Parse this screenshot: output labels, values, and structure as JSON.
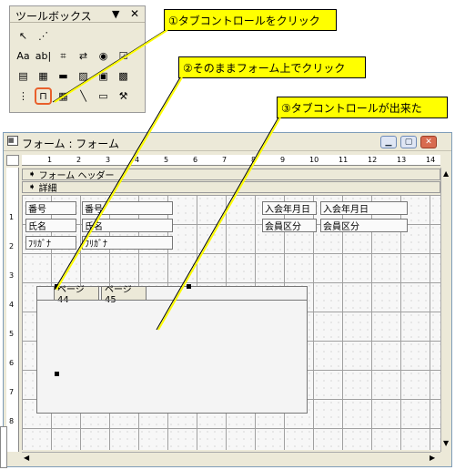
{
  "toolbox": {
    "title": "ツールボックス",
    "buttons": [
      {
        "name": "select-arrow-icon",
        "glyph": "↖"
      },
      {
        "name": "wizard-wand-icon",
        "glyph": "⋰"
      },
      {
        "name": "label-icon",
        "glyph": "Aa"
      },
      {
        "name": "textbox-icon",
        "glyph": "ab|"
      },
      {
        "name": "option-group-icon",
        "glyph": "⌗"
      },
      {
        "name": "toggle-button-icon",
        "glyph": "⇄"
      },
      {
        "name": "option-button-icon",
        "glyph": "◉"
      },
      {
        "name": "checkbox-icon",
        "glyph": "☑"
      },
      {
        "name": "combo-box-icon",
        "glyph": "▤"
      },
      {
        "name": "list-box-icon",
        "glyph": "▦"
      },
      {
        "name": "command-button-icon",
        "glyph": "▬"
      },
      {
        "name": "image-icon",
        "glyph": "▨"
      },
      {
        "name": "unbound-object-icon",
        "glyph": "▣"
      },
      {
        "name": "bound-object-icon",
        "glyph": "▩"
      },
      {
        "name": "page-break-icon",
        "glyph": "⋮"
      },
      {
        "name": "tab-control-icon",
        "glyph": "⊓"
      },
      {
        "name": "subform-icon",
        "glyph": "▦"
      },
      {
        "name": "line-icon",
        "glyph": "╲"
      },
      {
        "name": "rectangle-icon",
        "glyph": "▭"
      },
      {
        "name": "more-controls-icon",
        "glyph": "⚒"
      }
    ]
  },
  "callouts": {
    "step1": "①タブコントロールをクリック",
    "step2": "②そのままフォーム上でクリック",
    "step3": "③タブコントロールが出来た"
  },
  "form_window": {
    "title": "フォーム : フォーム",
    "bands": {
      "header": "フォーム ヘッダー",
      "detail": "詳細"
    },
    "fields": [
      {
        "label": "番号",
        "control": "番号"
      },
      {
        "label": "氏名",
        "control": "氏名"
      },
      {
        "label": "ﾌﾘｶﾞﾅ",
        "control": "ﾌﾘｶﾞﾅ"
      },
      {
        "label": "入会年月日",
        "control": "入会年月日"
      },
      {
        "label": "会員区分",
        "control": "会員区分"
      }
    ],
    "tab_control": {
      "pages": [
        "ページ44",
        "ページ45"
      ]
    },
    "ruler_top": [
      "1",
      "2",
      "3",
      "4",
      "5",
      "6",
      "7",
      "8",
      "9",
      "10",
      "11",
      "12",
      "13",
      "14"
    ],
    "ruler_left": [
      "1",
      "2",
      "3",
      "4",
      "5",
      "6",
      "7",
      "8"
    ]
  },
  "colors": {
    "callout_bg": "#ffff00",
    "highlight": "#e8602c",
    "window_bg": "#ece9d8"
  }
}
